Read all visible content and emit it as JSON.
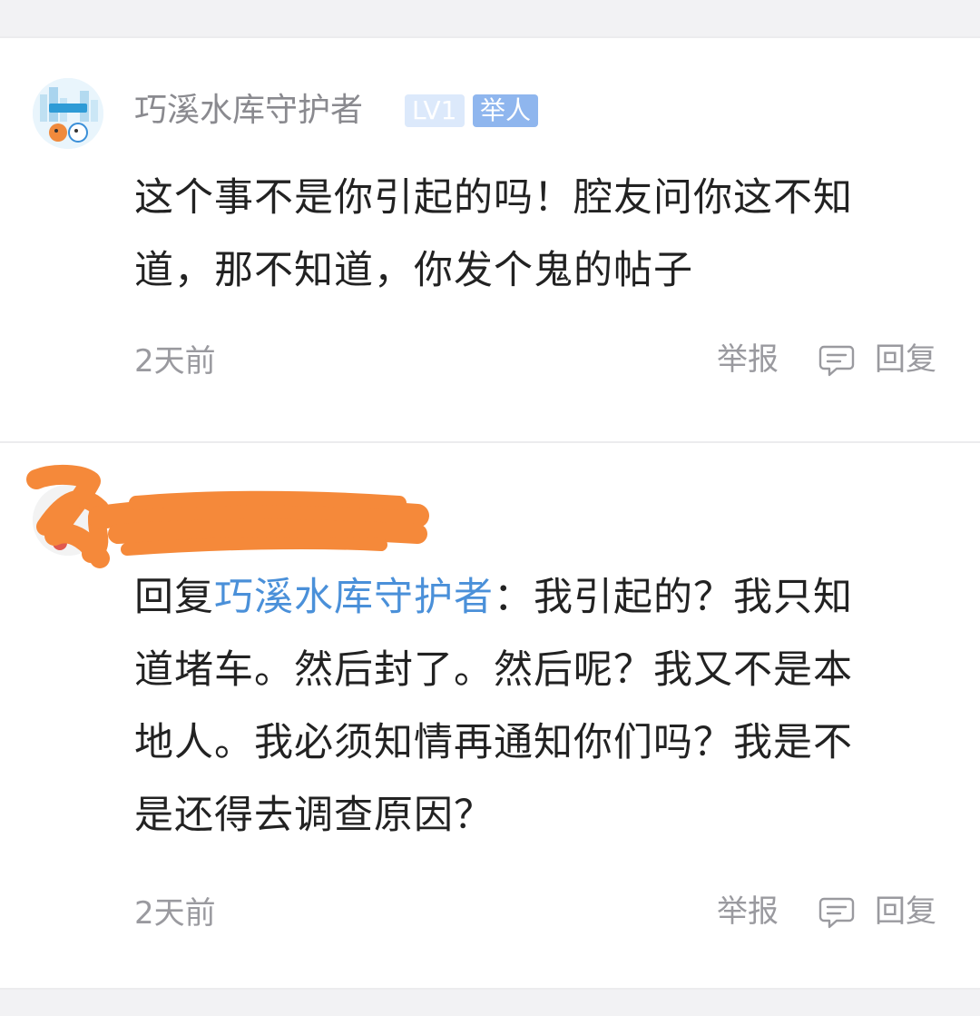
{
  "comments": [
    {
      "username": "巧溪水库守护者",
      "level_badge": "LV1",
      "role_badge": "举人",
      "text": "这个事不是你引起的吗！腔友问你这不知道，那不知道，你发个鬼的帖子",
      "time": "2天前",
      "report_label": "举报",
      "reply_label": "回复"
    },
    {
      "reply_prefix": "回复",
      "reply_target": "巧溪水库守护者",
      "reply_separator": "：",
      "text": "我引起的？我只知道堵车。然后封了。然后呢？我又不是本地人。我必须知情再通知你们吗？我是不是还得去调查原因？",
      "time": "2天前",
      "report_label": "举报",
      "reply_label": "回复"
    }
  ],
  "icons": {
    "reply": "comment-bubble-icon"
  },
  "colors": {
    "link": "#4a90d9",
    "meta_text": "#9a9a9f",
    "redaction": "#f5893a"
  }
}
